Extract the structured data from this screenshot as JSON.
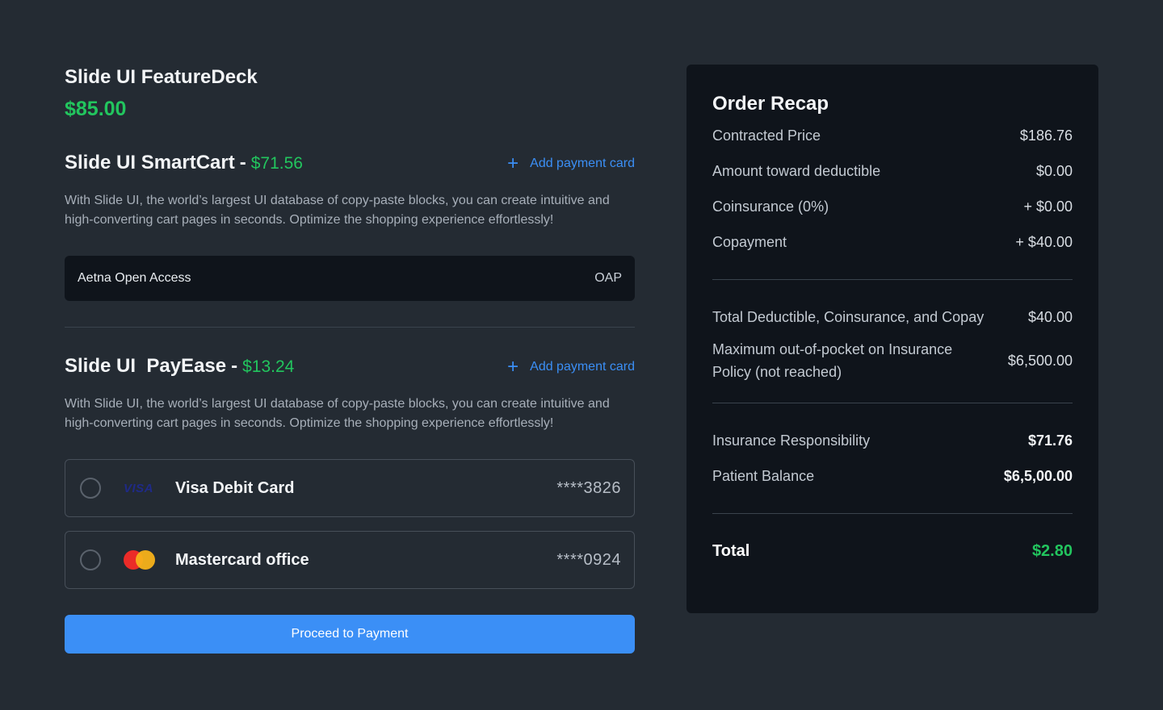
{
  "product": {
    "title": "Slide UI FeatureDeck",
    "price": "$85.00"
  },
  "section1": {
    "title": "Slide UI SmartCart",
    "separator": "-",
    "amount": "$71.56",
    "add_card_label": "Add payment card",
    "description": "With Slide UI, the world’s largest UI database of copy-paste blocks, you can create intuitive and high-converting cart pages in seconds. Optimize the shopping experience effortlessly!",
    "plan": {
      "name": "Aetna Open Access",
      "code": "OAP"
    }
  },
  "section2": {
    "title": "Slide UI  PayEase",
    "separator": "-",
    "amount": "$13.24",
    "add_card_label": "Add payment card",
    "description": "With Slide UI, the world’s largest UI database of copy-paste blocks, you can create intuitive and high-converting cart pages in seconds. Optimize the shopping experience effortlessly!",
    "cards": [
      {
        "brand": "VISA",
        "brand_icon": "visa-icon",
        "name": "Visa Debit Card",
        "number": "****3826"
      },
      {
        "brand": "Mastercard",
        "brand_icon": "mastercard-icon",
        "name": "Mastercard office",
        "number": "****0924"
      }
    ]
  },
  "proceed_label": "Proceed to Payment",
  "recap": {
    "title": "Order Recap",
    "group1": [
      {
        "label": "Contracted Price",
        "value": "$186.76"
      },
      {
        "label": "Amount toward deductible",
        "value": "$0.00"
      },
      {
        "label": "Coinsurance (0%)",
        "value": "+ $0.00"
      },
      {
        "label": "Copayment",
        "value": "+ $40.00"
      }
    ],
    "group2": [
      {
        "label": "Total Deductible, Coinsurance, and Copay",
        "value": "$40.00"
      },
      {
        "label": "Maximum out-of-pocket on Insurance Policy (not reached)",
        "value": "$6,500.00"
      }
    ],
    "group3": [
      {
        "label": "Insurance Responsibility",
        "value": "$71.76"
      },
      {
        "label": "Patient Balance",
        "value": "$6,5,00.00"
      }
    ],
    "total": {
      "label": "Total",
      "value": "$2.80"
    }
  },
  "colors": {
    "accent": "#3b8ff6",
    "price_green": "#22c55e",
    "background": "#242b33",
    "panel": "#0f141b"
  }
}
